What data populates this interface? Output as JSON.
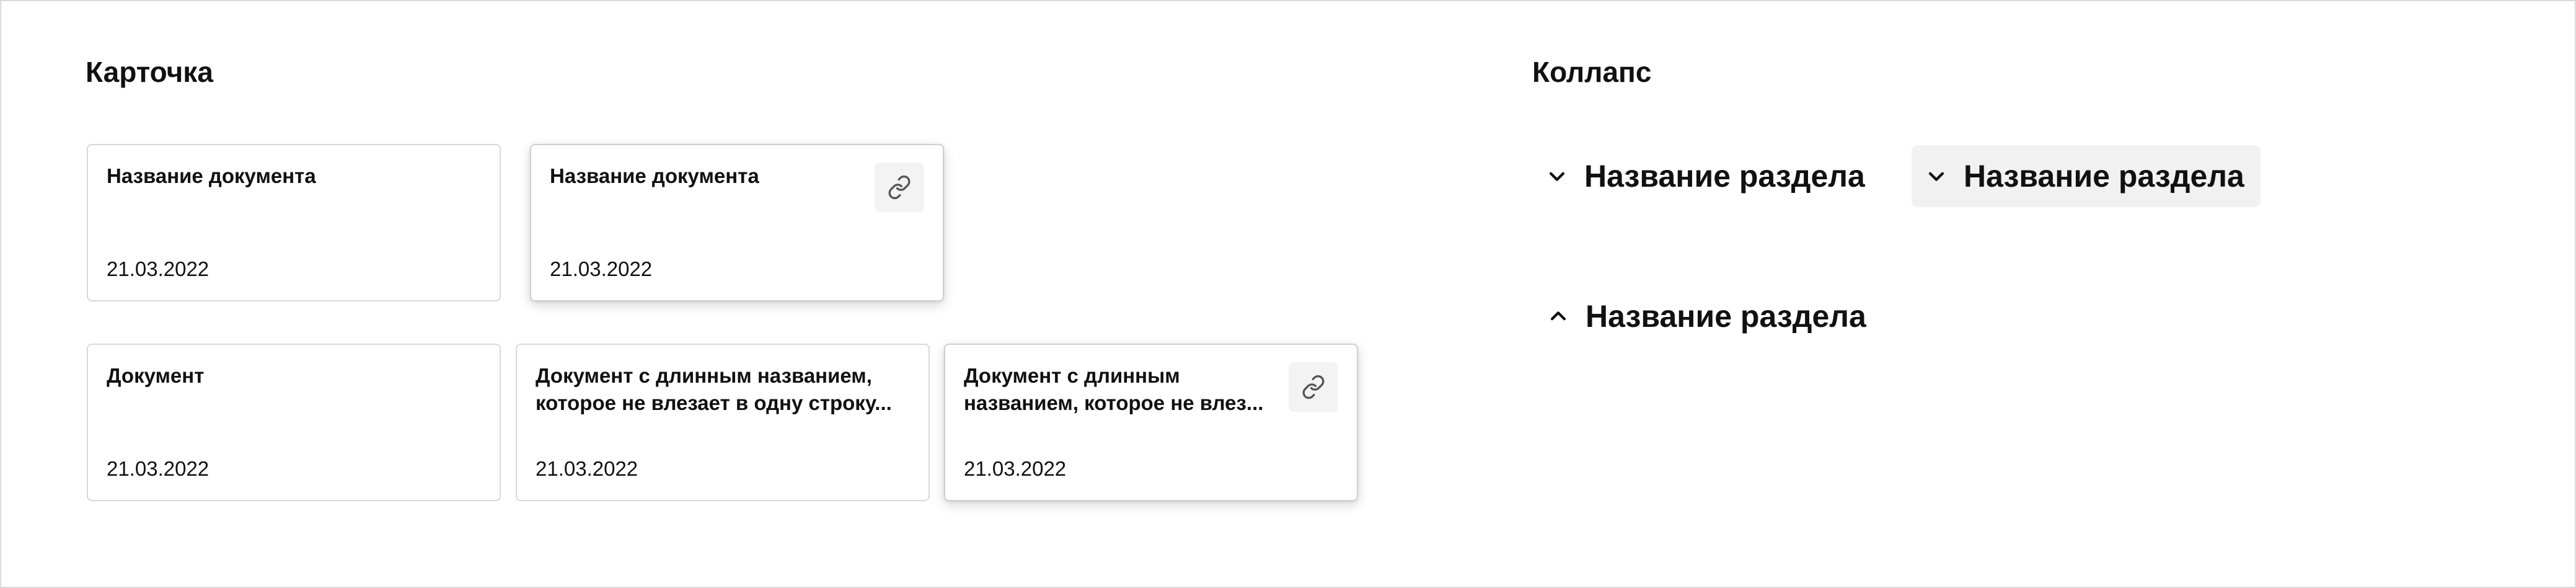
{
  "card_section": {
    "title": "Карточка",
    "cards": [
      {
        "title": "Название документа",
        "date": "21.03.2022"
      },
      {
        "title": "Название документа",
        "date": "21.03.2022",
        "action_icon": "link-icon"
      },
      {
        "title": "Документ",
        "date": "21.03.2022"
      },
      {
        "title": "Документ с длинным названием, которое не влезает в одну строку...",
        "date": "21.03.2022"
      },
      {
        "title": "Документ с длинным названием, которое не влез...",
        "date": "21.03.2022",
        "action_icon": "link-icon"
      }
    ]
  },
  "collapse_section": {
    "title": "Коллапс",
    "items": [
      {
        "label": "Название раздела",
        "icon": "chevron-down-icon",
        "state": "collapsed"
      },
      {
        "label": "Название раздела",
        "icon": "chevron-down-icon",
        "state": "collapsed-hover"
      },
      {
        "label": "Название раздела",
        "icon": "chevron-up-icon",
        "state": "expanded"
      }
    ]
  },
  "colors": {
    "text": "#111111",
    "card_border": "#d8d8d8",
    "icon_button_bg": "#f3f3f3",
    "collapse_hover_bg": "#f1f1f1",
    "icon_color": "#555555"
  }
}
